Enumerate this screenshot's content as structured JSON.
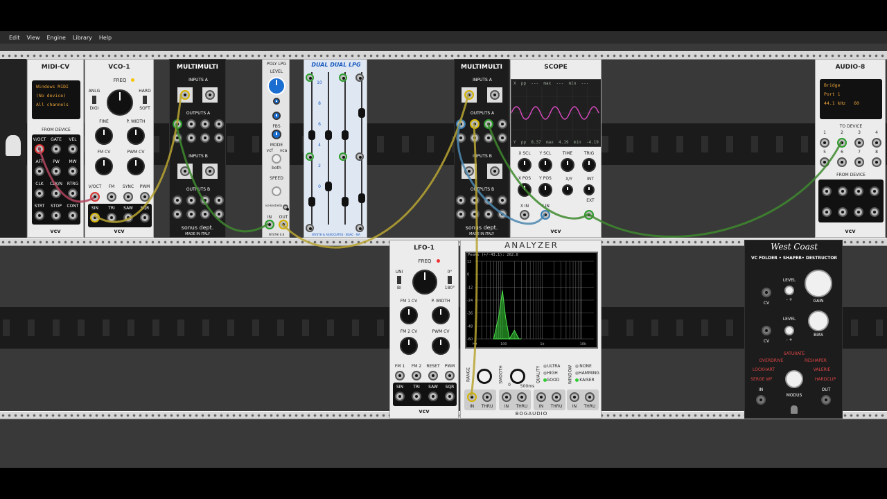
{
  "menu": [
    "Edit",
    "View",
    "Engine",
    "Library",
    "Help"
  ],
  "midi_cv": {
    "title": "MIDI-CV",
    "driver": "Windows MIDI",
    "device": "(No device)",
    "channel": "All channels",
    "section": "FROM DEVICE",
    "jacks": [
      "V/OCT",
      "GATE",
      "VEL",
      "AFT",
      "PW",
      "MW",
      "CLK",
      "CLK/N",
      "RTRG",
      "STRT",
      "STOP",
      "CONT"
    ],
    "brand": "vcv"
  },
  "vco1": {
    "title": "VCO-1",
    "freq": "FREQ",
    "anlg": "ANLG",
    "digi": "DIGI",
    "hard": "HARD",
    "soft": "SOFT",
    "fine": "FINE",
    "pwidth": "P. WIDTH",
    "fmcv": "FM CV",
    "pwmcv": "PWM CV",
    "inputs": [
      "V/OCT",
      "FM",
      "SYNC",
      "PWM"
    ],
    "outputs": [
      "SIN",
      "TRI",
      "SAW",
      "SQR"
    ],
    "brand": "vcv"
  },
  "multimulti1": {
    "title": "MULTIMULTI",
    "inputs_a": "INPUTS A",
    "outputs_a": "OUTPUTS A",
    "inputs_b": "INPUTS B",
    "outputs_b": "OUTPUTS B",
    "brand": "sonus dept.",
    "made": "MADE IN ITALY"
  },
  "polylpg": {
    "title": "POLY LPG",
    "level": "LEVEL",
    "fbs": "FBS",
    "mode": "MODE",
    "vcf": "vcf",
    "vca": "vca",
    "both": "both",
    "speed": "SPEED",
    "brand": "ice·kestrella",
    "in": "IN",
    "out": "OUT",
    "footer": "NYSTHI 0.8"
  },
  "dual_lpg": {
    "title": "DUAL DUAL LPG",
    "footer": "WYSTH & ASSOCIATES · BGAC · NA",
    "marks": [
      "10",
      "8",
      "6",
      "4",
      "2",
      "0"
    ]
  },
  "multimulti2": {
    "title": "MULTIMULTI",
    "inputs_a": "INPUTS A",
    "outputs_a": "OUTPUTS A",
    "inputs_b": "INPUTS B",
    "outputs_b": "OUTPUTS B",
    "brand": "sonus dept.",
    "made": "MADE IN ITALY"
  },
  "scope": {
    "title": "SCOPE",
    "top_readout": [
      "X",
      "pp",
      "---",
      "max",
      "---",
      "min",
      "---"
    ],
    "bottom_readout": [
      "Y",
      "pp",
      "8.37",
      "max",
      "4.19",
      "min",
      "-4.19"
    ],
    "xscl": "X SCL",
    "yscl": "Y SCL",
    "time": "TIME",
    "trig": "TRIG",
    "xpos": "X POS",
    "ypos": "Y POS",
    "xy": "X/Y",
    "int": "INT",
    "xin": "X IN",
    "yin": "Y IN",
    "ext": "EXT",
    "brand": "vcv"
  },
  "audio8": {
    "title": "AUDIO-8",
    "driver": "Bridge",
    "port": "Port 1",
    "rate": "44.1 kHz",
    "buffer": "60",
    "to_device": "TO DEVICE",
    "from_device": "FROM DEVICE",
    "nums": [
      "1",
      "2",
      "3",
      "4",
      "5",
      "6",
      "7",
      "8"
    ],
    "brand": "vcv"
  },
  "lfo1": {
    "title": "LFO-1",
    "freq": "FREQ",
    "uni": "UNI",
    "bi": "BI",
    "deg0": "0°",
    "deg180": "180°",
    "fm1cv": "FM 1 CV",
    "pwidth": "P. WIDTH",
    "fm2cv": "FM 2 CV",
    "pwmcv": "PWM CV",
    "inputs": [
      "FM 1",
      "FM 2",
      "RESET",
      "PWM"
    ],
    "outputs": [
      "SIN",
      "TRI",
      "SAW",
      "SQR"
    ],
    "brand": "vcv"
  },
  "analyzer": {
    "title": "ANALYZER",
    "readout": "Peaks (+/-43.1):",
    "readout_val": "262.0",
    "yticks": [
      "12",
      "0",
      "-12",
      "-24",
      "-36",
      "-48",
      "-60"
    ],
    "xticks": [
      "Hz",
      "100",
      "1k",
      "10k"
    ],
    "range": "RANGE",
    "smooth": "SMOOTH",
    "ms0": "0",
    "ms500": "500ms",
    "quality": "QUALITY",
    "q_opts": [
      "ULTRA",
      "HIGH",
      "GOOD"
    ],
    "window": "WINDOW",
    "w_opts": [
      "NONE",
      "HAMMING",
      "KAISER"
    ],
    "jack_labels": [
      "IN",
      "THRU",
      "IN",
      "THRU",
      "IN",
      "THRU",
      "IN",
      "THRU"
    ],
    "brand": "BOGAUDIO",
    "chart_data": {
      "type": "area",
      "x": [
        60,
        80,
        100,
        120,
        150,
        200,
        260,
        300
      ],
      "values": [
        -60,
        -40,
        -15,
        -40,
        -60,
        -52,
        -60,
        -60
      ]
    }
  },
  "westcoast": {
    "title": "West Coast",
    "subtitle": "VC FOLDER • SHAPER• DESTRUCTOR",
    "level1": "LEVEL",
    "level2": "LEVEL",
    "cv1": "CV",
    "cv2": "CV",
    "gain": "GAIN",
    "bias": "BIAS",
    "modes": [
      "SATURATE",
      "OVERDRIVE",
      "RESHAPER",
      "LOCKHART",
      "VALERIE",
      "SERGE WF",
      "HARDCLIP"
    ],
    "modus": "MODUS",
    "in": "IN",
    "out": "OUT",
    "pm": "- +"
  }
}
